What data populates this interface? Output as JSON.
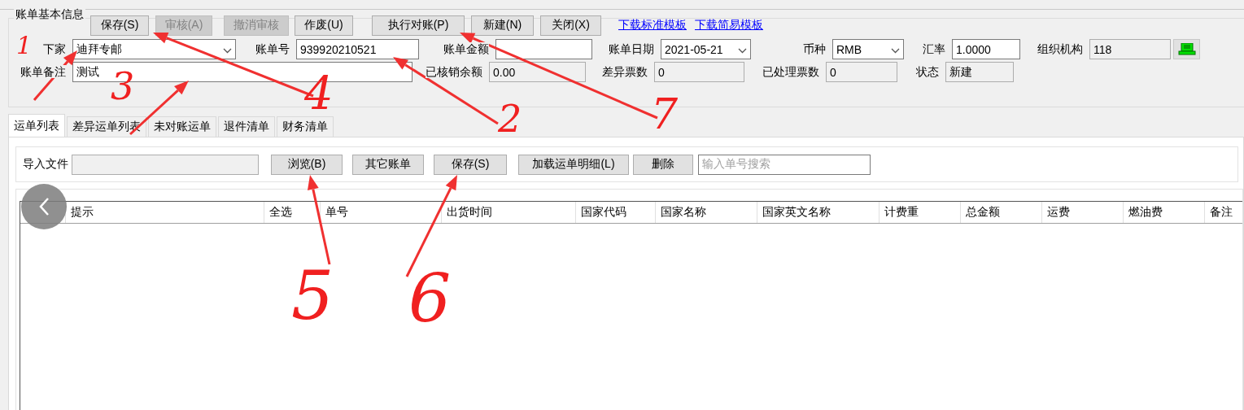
{
  "form_title": "账单基本信息",
  "toolbar": [
    {
      "label": "保存(S)",
      "disabled": false
    },
    {
      "label": "审核(A)",
      "disabled": true
    },
    {
      "label": "撤消审核",
      "disabled": true
    },
    {
      "label": "作废(U)",
      "disabled": false
    },
    {
      "label": "执行对账(P)",
      "disabled": false
    },
    {
      "label": "新建(N)",
      "disabled": false
    },
    {
      "label": "关闭(X)",
      "disabled": false
    }
  ],
  "links": [
    "下载标准模板",
    "下载简易模板"
  ],
  "field_rows": [
    [
      {
        "label": "下家",
        "value": "迪拜专邮",
        "kind": "combo"
      },
      {
        "label": "账单号",
        "value": "939920210521",
        "kind": "text"
      },
      {
        "label": "账单金额",
        "kind": "text"
      },
      {
        "label": "账单日期",
        "value": "2021-05-21",
        "kind": "combo"
      },
      {
        "label": "币种",
        "value": "RMB",
        "kind": "combo"
      },
      {
        "label": "汇率",
        "value": "1.0000",
        "kind": "text"
      },
      {
        "label": "组织机构",
        "value": "118",
        "kind": "readonly"
      }
    ],
    [
      {
        "label": "账单备注",
        "value": "测试",
        "kind": "text"
      },
      {
        "label": "已核销余额",
        "value": "0.00",
        "kind": "readonly"
      },
      {
        "label": "差异票数",
        "value": "0",
        "kind": "readonly"
      },
      {
        "label": "已处理票数",
        "value": "0",
        "kind": "readonly"
      },
      {
        "label": "状态",
        "value": "新建",
        "kind": "readonly"
      }
    ]
  ],
  "tabs": [
    {
      "label": "运单列表",
      "selected": true
    },
    {
      "label": "差异运单列表",
      "selected": false
    },
    {
      "label": "未对账运单",
      "selected": false
    },
    {
      "label": "退件清单",
      "selected": false
    },
    {
      "label": "财务清单",
      "selected": false
    }
  ],
  "import": {
    "label": "导入文件",
    "buttons": [
      "浏览(B)",
      "其它账单",
      "保存(S)",
      "加载运单明细(L)",
      "删除"
    ],
    "search_placeholder": "输入单号搜索"
  },
  "table": {
    "columns": [
      "提示",
      "全选",
      "单号",
      "出货时间",
      "国家代码",
      "国家名称",
      "国家英文名称",
      "计费重",
      "总金额",
      "运费",
      "燃油费",
      "备注"
    ]
  },
  "annotations": [
    {
      "label": "1"
    },
    {
      "label": "3"
    },
    {
      "label": "4"
    },
    {
      "label": "2"
    },
    {
      "label": "7"
    },
    {
      "label": "5"
    },
    {
      "label": "6"
    }
  ]
}
